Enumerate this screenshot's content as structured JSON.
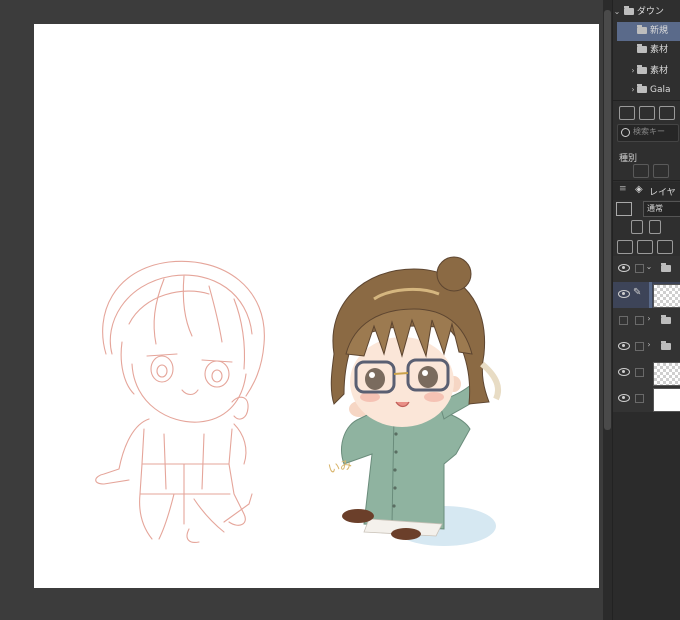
{
  "material_tree": {
    "root": "ダウン",
    "items": [
      {
        "label": "新規",
        "selected": true
      },
      {
        "label": "素材",
        "selected": false
      },
      {
        "label": "素材",
        "selected": false
      },
      {
        "label": "Gala",
        "selected": false
      }
    ]
  },
  "material_search": {
    "placeholder": "検索キー"
  },
  "material_kind_label": "種別",
  "layer_panel": {
    "title": "レイヤー",
    "blend_mode": "通常",
    "layers": [
      {
        "name": "folder-open",
        "kind": "folder"
      },
      {
        "name": "sketch-layer",
        "kind": "raster",
        "selected": true
      },
      {
        "name": "folder",
        "kind": "folder"
      },
      {
        "name": "folder",
        "kind": "folder"
      },
      {
        "name": "transparent",
        "kind": "raster"
      },
      {
        "name": "paper",
        "kind": "paper"
      }
    ]
  },
  "signature_text": "いみ",
  "colors": {
    "workspace": "#3c3c3c",
    "panel": "#2f2f2f",
    "selection": "#5a6a8a",
    "sketch_line": "#e5a59a",
    "coat": "#8fb3a0",
    "hair": "#8b6a44"
  }
}
